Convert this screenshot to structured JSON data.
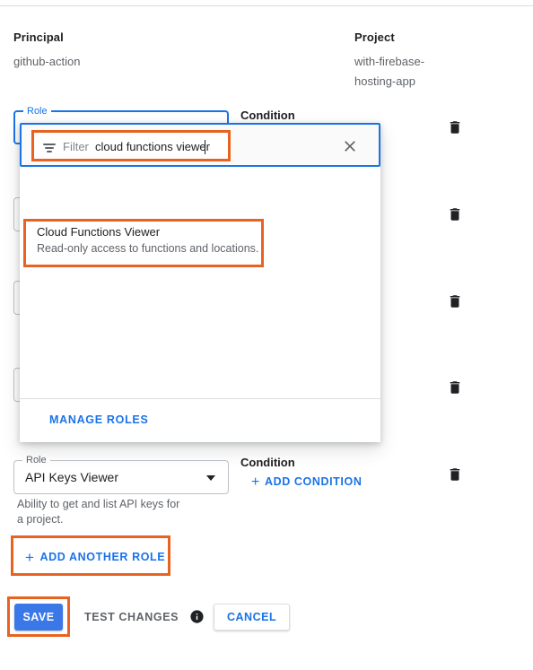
{
  "colors": {
    "accent_blue": "#1a73e8",
    "button_blue": "#3b78e7",
    "highlight_orange": "#e8631f",
    "text_primary": "#202124",
    "text_secondary": "#5f6368"
  },
  "header": {
    "principal_label": "Principal",
    "principal_value": "github-action",
    "project_label": "Project",
    "project_value": "with-firebase-hosting-app"
  },
  "role_rows": [
    {
      "legend": "Role",
      "value": "",
      "focused": true
    },
    {
      "legend": "Role",
      "value": ""
    },
    {
      "legend": "Role",
      "value": ""
    },
    {
      "legend": "Role",
      "value": ""
    }
  ],
  "condition": {
    "label": "Condition",
    "add_label": "ADD CONDITION",
    "plus": "+"
  },
  "role_dropdown": {
    "filter": {
      "icon": "filter-icon",
      "label": "Filter",
      "value": "cloud functions viewer",
      "placeholder": "Filter",
      "clear_icon": "close-icon"
    },
    "options": [
      {
        "title": "Cloud Functions Viewer",
        "description": "Read-only access to functions and locations.",
        "highlighted": true
      }
    ],
    "footer_label": "MANAGE ROLES"
  },
  "selected_role": {
    "legend": "Role",
    "value": "API Keys Viewer",
    "description": "Ability to get and list API keys for a project.",
    "caret_icon": "chevron-down-icon"
  },
  "add_another_role": {
    "label": "ADD ANOTHER ROLE",
    "plus": "+"
  },
  "actions": {
    "save_label": "SAVE",
    "test_changes_label": "TEST CHANGES",
    "info_icon": "info-icon",
    "cancel_label": "CANCEL"
  },
  "delete_icons": {
    "name": "delete-icon",
    "count": 5
  }
}
